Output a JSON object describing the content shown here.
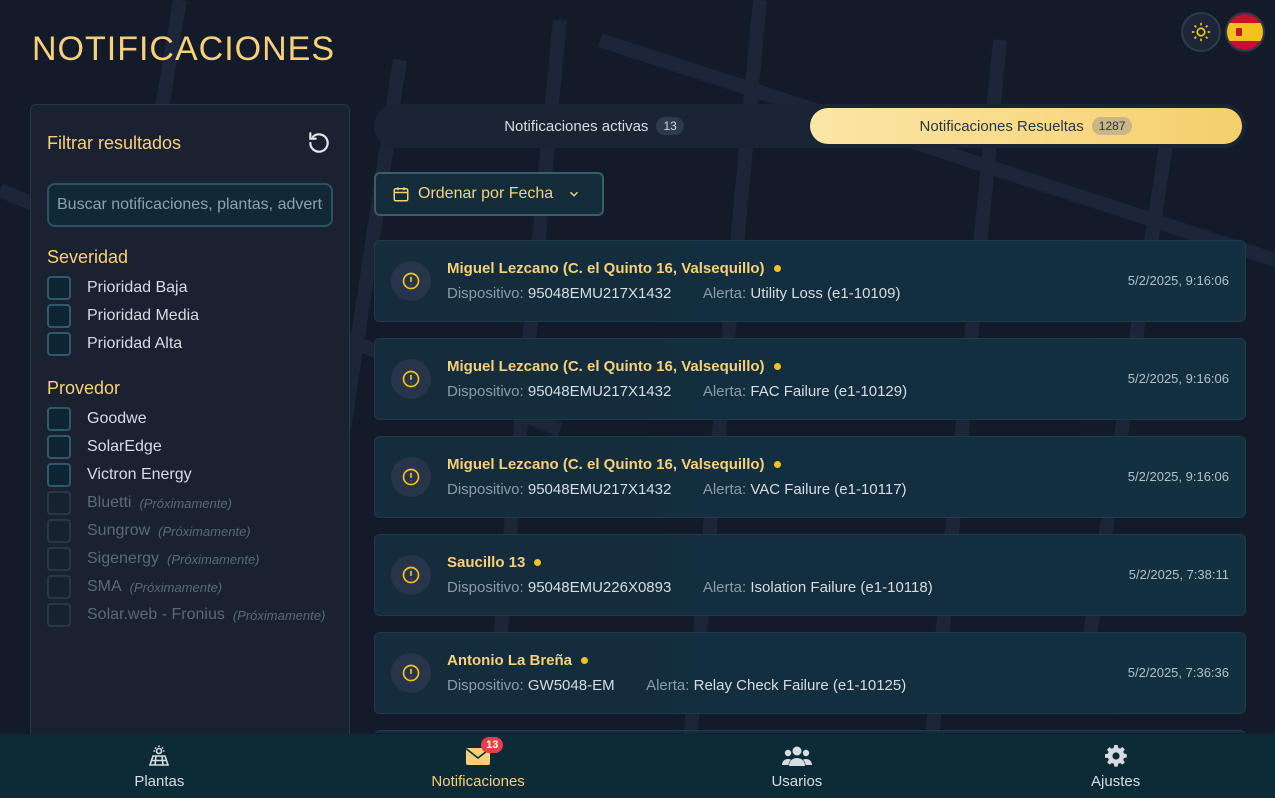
{
  "page": {
    "title": "NOTIFICACIONES"
  },
  "top_controls": {
    "theme_icon": "sun-icon",
    "language_icon": "spain-flag-icon"
  },
  "sidebar": {
    "title": "Filtrar resultados",
    "reset_icon": "refresh-icon",
    "search_placeholder": "Buscar notificaciones, plantas, advertencias...",
    "severity": {
      "title": "Severidad",
      "options": [
        "Prioridad Baja",
        "Prioridad Media",
        "Prioridad Alta"
      ]
    },
    "provider": {
      "title": "Provedor",
      "options": [
        "Goodwe",
        "SolarEdge",
        "Victron Energy"
      ],
      "soon_options": [
        "Bluetti",
        "Sungrow",
        "Sigenergy",
        "SMA",
        "Solar.web - Fronius"
      ],
      "soon_label": "(Próximamente)"
    }
  },
  "tabs": [
    {
      "label": "Notificaciones activas",
      "count": "13",
      "active": false
    },
    {
      "label": "Notificaciones Resueltas",
      "count": "1287",
      "active": true
    }
  ],
  "sort": {
    "label": "Ordenar por Fecha",
    "icon": "calendar-icon"
  },
  "labels": {
    "device": "Dispositivo:",
    "alert": "Alerta:"
  },
  "notifications": [
    {
      "title": "Miguel Lezcano (C. el Quinto 16, Valsequillo)",
      "device": "95048EMU217X1432",
      "alert": "Utility Loss (e1-10109)",
      "time": "5/2/2025, 9:16:06"
    },
    {
      "title": "Miguel Lezcano (C. el Quinto 16, Valsequillo)",
      "device": "95048EMU217X1432",
      "alert": "FAC Failure (e1-10129)",
      "time": "5/2/2025, 9:16:06"
    },
    {
      "title": "Miguel Lezcano (C. el Quinto 16, Valsequillo)",
      "device": "95048EMU217X1432",
      "alert": "VAC Failure (e1-10117)",
      "time": "5/2/2025, 9:16:06"
    },
    {
      "title": "Saucillo 13",
      "device": "95048EMU226X0893",
      "alert": "Isolation Failure (e1-10118)",
      "time": "5/2/2025, 7:38:11"
    },
    {
      "title": "Antonio La Breña",
      "device": "GW5048-EM",
      "alert": "Relay Check Failure (e1-10125)",
      "time": "5/2/2025, 7:36:36"
    }
  ],
  "bottom_nav": [
    {
      "label": "Plantas",
      "icon": "solar-plant-icon",
      "active": false
    },
    {
      "label": "Notificaciones",
      "icon": "envelope-icon",
      "active": true,
      "badge": "13"
    },
    {
      "label": "Usarios",
      "icon": "users-icon",
      "active": false
    },
    {
      "label": "Ajustes",
      "icon": "gear-icon",
      "active": false
    }
  ],
  "colors": {
    "accent": "#f7d079",
    "background": "#131b2b",
    "badge": "#e2404a"
  }
}
